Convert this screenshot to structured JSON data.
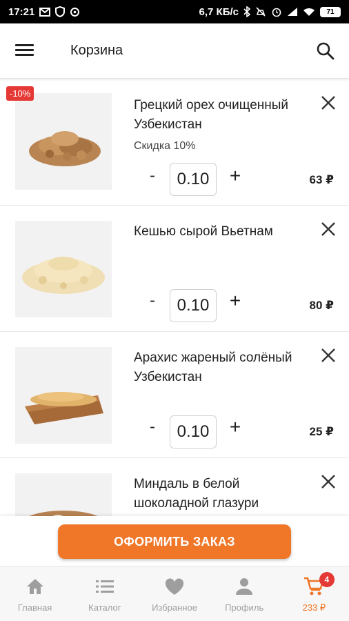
{
  "status_bar": {
    "time": "17:21",
    "left_icons": [
      "gmail-icon",
      "shield-icon",
      "sync-icon"
    ],
    "net_speed": "6,7 КБ/с",
    "right_icons": [
      "bluetooth-icon",
      "mute-icon",
      "alarm-icon",
      "signal-icon",
      "wifi-icon"
    ],
    "battery": "71"
  },
  "app_bar": {
    "title": "Корзина",
    "menu_icon": "hamburger-icon",
    "search_icon": "search-icon"
  },
  "cart": {
    "items": [
      {
        "name": "Грецкий орех очищенный Узбекистан",
        "subtitle": "Скидка 10%",
        "badge": "-10%",
        "quantity": "0.10",
        "price": "63 ₽",
        "minus": "-",
        "plus": "+",
        "image": "walnut-image"
      },
      {
        "name": "Кешью сырой Вьетнам",
        "subtitle": "",
        "badge": "",
        "quantity": "0.10",
        "price": "80 ₽",
        "minus": "-",
        "plus": "+",
        "image": "cashew-image"
      },
      {
        "name": "Арахис жареный солёный Узбекистан",
        "subtitle": "",
        "badge": "",
        "quantity": "0.10",
        "price": "25 ₽",
        "minus": "-",
        "plus": "+",
        "image": "peanut-image"
      },
      {
        "name": "Миндаль в белой шоколадной глазури",
        "subtitle": "",
        "badge": "",
        "quantity": "",
        "price": "",
        "image": "almond-image"
      }
    ]
  },
  "checkout": {
    "label": "ОФОРМИТЬ ЗАКАЗ",
    "color": "#f07628"
  },
  "bottom_nav": {
    "items": [
      {
        "label": "Главная",
        "icon": "home-icon"
      },
      {
        "label": "Каталог",
        "icon": "list-icon"
      },
      {
        "label": "Избранное",
        "icon": "heart-icon"
      },
      {
        "label": "Профиль",
        "icon": "person-icon"
      },
      {
        "label": "233 ₽",
        "icon": "cart-icon",
        "badge": "4",
        "active": true
      }
    ]
  },
  "colors": {
    "accent": "#f07628",
    "badge": "#e53935",
    "inactive": "#9e9e9e"
  }
}
